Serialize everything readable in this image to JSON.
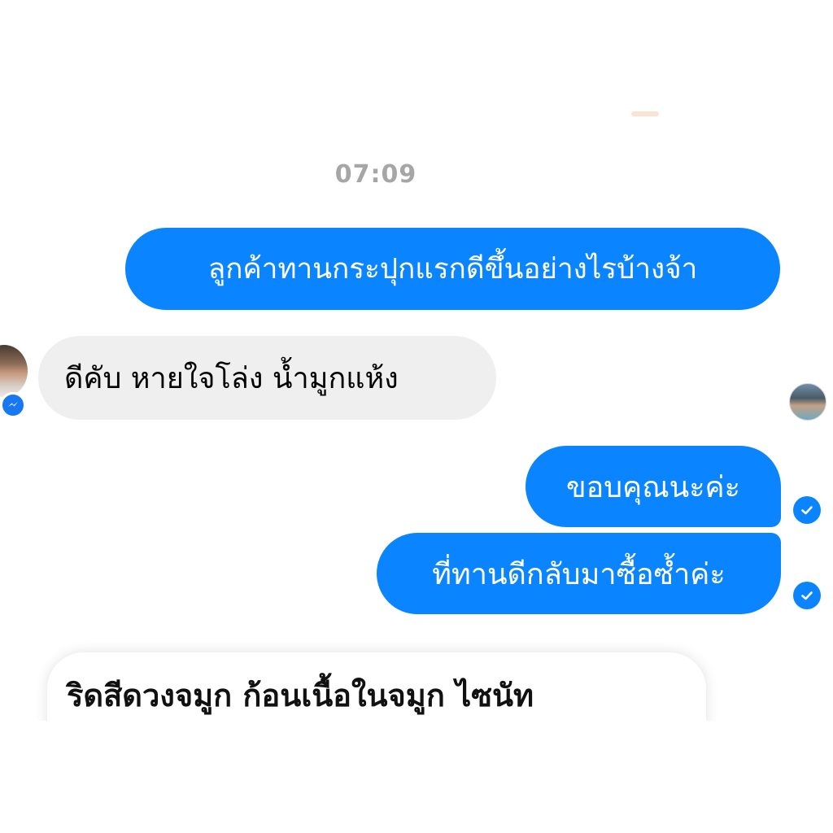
{
  "conversation": {
    "timestamp": "07:09",
    "messages": [
      {
        "direction": "outgoing",
        "text": "ลูกค้าทานกระปุกแรกดีขึ้นอย่างไรบ้างจ้า"
      },
      {
        "direction": "incoming",
        "text": "ดีคับ หายใจโล่ง น้ำมูกแห้ง"
      },
      {
        "direction": "outgoing",
        "text": "ขอบคุณนะค่ะ",
        "status": "delivered"
      },
      {
        "direction": "outgoing",
        "text": "ที่ทานดีกลับมาซื้อซ้ำค่ะ",
        "status": "delivered"
      }
    ]
  },
  "overlay_caption": {
    "text": "ริดสีดวงจมูก ก้อนเนื้อในจมูก ไซนัท"
  },
  "colors": {
    "outgoing_bubble": "#0a84ff",
    "incoming_bubble": "#efefef",
    "timestamp": "#a6a6a6",
    "messenger_badge": "#1877f2"
  },
  "icons": {
    "delivered": "check-circle-icon",
    "messenger": "messenger-icon"
  }
}
